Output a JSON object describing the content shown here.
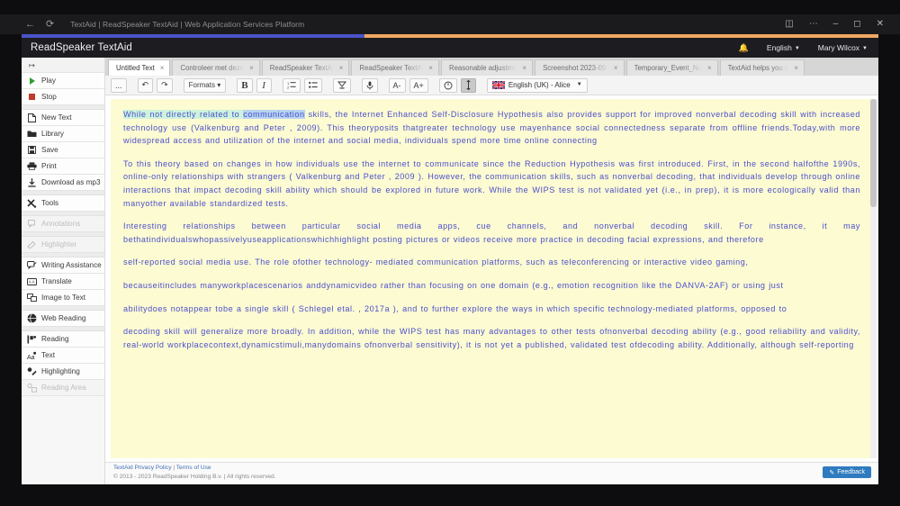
{
  "browser": {
    "back_icon": "back-arrow-icon",
    "reload_icon": "reload-icon",
    "title": "TextAid | ReadSpeaker TextAid | Web Application Services Platform",
    "window_controls": [
      "split-icon",
      "more-icon",
      "minimize-icon",
      "restore-icon",
      "close-icon"
    ]
  },
  "accent": {
    "blue": "#4b53c8",
    "orange": "#f0a862"
  },
  "appbar": {
    "brand": "ReadSpeaker TextAid",
    "notification_icon": "bell-icon",
    "language": "English",
    "user": "Mary Wilcox",
    "caret": "▾"
  },
  "sidebar": {
    "collapse_label": "",
    "collapse_icon": "collapse-panel-icon",
    "items": [
      {
        "icon": "play-icon",
        "label": "Play",
        "disabled": false
      },
      {
        "icon": "stop-icon",
        "label": "Stop",
        "disabled": false
      },
      {
        "icon": "new-text-icon",
        "label": "New Text",
        "disabled": false
      },
      {
        "icon": "library-folder-icon",
        "label": "Library",
        "disabled": false
      },
      {
        "icon": "save-floppy-icon",
        "label": "Save",
        "disabled": false
      },
      {
        "icon": "print-icon",
        "label": "Print",
        "disabled": false
      },
      {
        "icon": "download-icon",
        "label": "Download as mp3",
        "disabled": false
      },
      {
        "icon": "tools-icon",
        "label": "Tools",
        "disabled": false
      },
      {
        "icon": "annotations-icon",
        "label": "Annotations",
        "disabled": true
      },
      {
        "icon": "highlighter-icon",
        "label": "Highlighter",
        "disabled": true
      },
      {
        "icon": "writing-assistance-icon",
        "label": "Writing Assistance",
        "disabled": false
      },
      {
        "icon": "translate-icon",
        "label": "Translate",
        "disabled": false
      },
      {
        "icon": "image-to-text-icon",
        "label": "Image to Text",
        "disabled": false
      },
      {
        "icon": "web-reading-icon",
        "label": "Web Reading",
        "disabled": false
      },
      {
        "icon": "reading-icon",
        "label": "Reading",
        "disabled": false
      },
      {
        "icon": "text-icon",
        "label": "Text",
        "disabled": false
      },
      {
        "icon": "highlighting-icon",
        "label": "Highlighting",
        "disabled": false
      },
      {
        "icon": "reading-area-icon",
        "label": "Reading Area",
        "disabled": true
      }
    ]
  },
  "tabs": [
    {
      "label": "Untitled Text",
      "active": true
    },
    {
      "label": "Controleer met deze",
      "active": false
    },
    {
      "label": "ReadSpeaker TextAi",
      "active": false
    },
    {
      "label": "ReadSpeaker TextAi",
      "active": false
    },
    {
      "label": "Reasonable adjustme",
      "active": false
    },
    {
      "label": "Screenshot 2023-09-",
      "active": false
    },
    {
      "label": "Temporary_Event_No",
      "active": false
    },
    {
      "label": "TextAid helps you a",
      "active": false
    }
  ],
  "tab_close_label": "×",
  "toolbar": {
    "more_label": "...",
    "undo_label": "↶",
    "redo_label": "↷",
    "formats_label": "Formats",
    "formats_caret": "▾",
    "bold_label": "B",
    "italic_label": "I",
    "numbered_list_icon": "numbered-list-icon",
    "bullet_list_icon": "bullet-list-icon",
    "text_color_icon": "text-color-icon",
    "microphone_icon": "microphone-icon",
    "decrease_font_label": "A-",
    "increase_font_label": "A+",
    "speed_icon": "speed-gauge-icon",
    "line_spacing_icon": "line-spacing-icon",
    "language_voice": "English (UK) - Alice",
    "language_caret": "▾",
    "flag_icon": "uk-flag-icon"
  },
  "editor": {
    "paragraphs": [
      {
        "runs": [
          {
            "text": "While not directly related to ",
            "highlight": "green"
          },
          {
            "text": "communication",
            "highlight": "blue"
          },
          {
            "text": " skills, the Internet Enhanced Self-Disclosure Hypothesis also provides support for improved nonverbal decoding skill with increased technology use (Valkenburg and Peter , 2009). This theoryposits thatgreater technology use mayenhance social connectedness separate from offline friends.Today,with more widespread access and utilization of the internet and social media, individuals spend more time online connecting",
            "highlight": "none"
          }
        ]
      },
      {
        "runs": [
          {
            "text": "To this theory based on changes in how individuals use the internet to communicate since the Reduction Hypothesis was first introduced. First, in the second halfofthe 1990s, online-only relationships with strangers ( Valkenburg and Peter , 2009 ). However, the communication skills, such as nonverbal decoding, that individuals develop through online interactions that impact decoding skill ability which should be explored in future work. While the WIPS test is not validated yet (i.e., in prep), it is more ecologically valid than manyother available standardized tests.",
            "highlight": "none"
          }
        ]
      },
      {
        "runs": [
          {
            "text": "Interesting relationships between particular social media apps, cue channels, and nonverbal decoding skill. For instance, it may bethatindividualswhopassivelyuseapplicationswhichhighlight posting pictures or videos receive more practice in decoding facial expressions, and therefore",
            "highlight": "none"
          }
        ]
      },
      {
        "runs": [
          {
            "text": "self-reported social media use. The role ofother technology- mediated communication platforms, such as teleconferencing or interactive video gaming,",
            "highlight": "none"
          }
        ]
      },
      {
        "runs": [
          {
            "text": "becauseitincludes manyworkplacescenarios anddynamicvideo rather than focusing on one domain (e.g., emotion recognition like the DANVA-2AF) or using just",
            "highlight": "none"
          }
        ]
      },
      {
        "runs": [
          {
            "text": "abilitydoes notappear tobe a single skill ( Schlegel etal. , 2017a ), and to further explore the ways in which specific technology-mediated platforms, opposed to",
            "highlight": "none"
          }
        ]
      },
      {
        "runs": [
          {
            "text": "decoding skill will generalize more broadly. In addition, while the WIPS test has many advantages to other tests ofnonverbal decoding ability (e.g., good reliability and validity, real-world workplacecontext,dynamicstimuli,manydomains ofnonverbal sensitivity), it is not yet a published, validated test ofdecoding ability. Additionally, although self-reporting",
            "highlight": "none"
          }
        ]
      }
    ],
    "background_color": "#fcfbd2",
    "text_color": "#4b4ecb"
  },
  "footer": {
    "privacy_policy": "TextAid Privacy Policy",
    "separator": " | ",
    "terms": "Terms of Use",
    "copyright": "© 2013 - 2023 ReadSpeaker Holding B.v. | All rights reserved.",
    "feedback_label": "Feedback",
    "feedback_icon": "feedback-icon"
  }
}
